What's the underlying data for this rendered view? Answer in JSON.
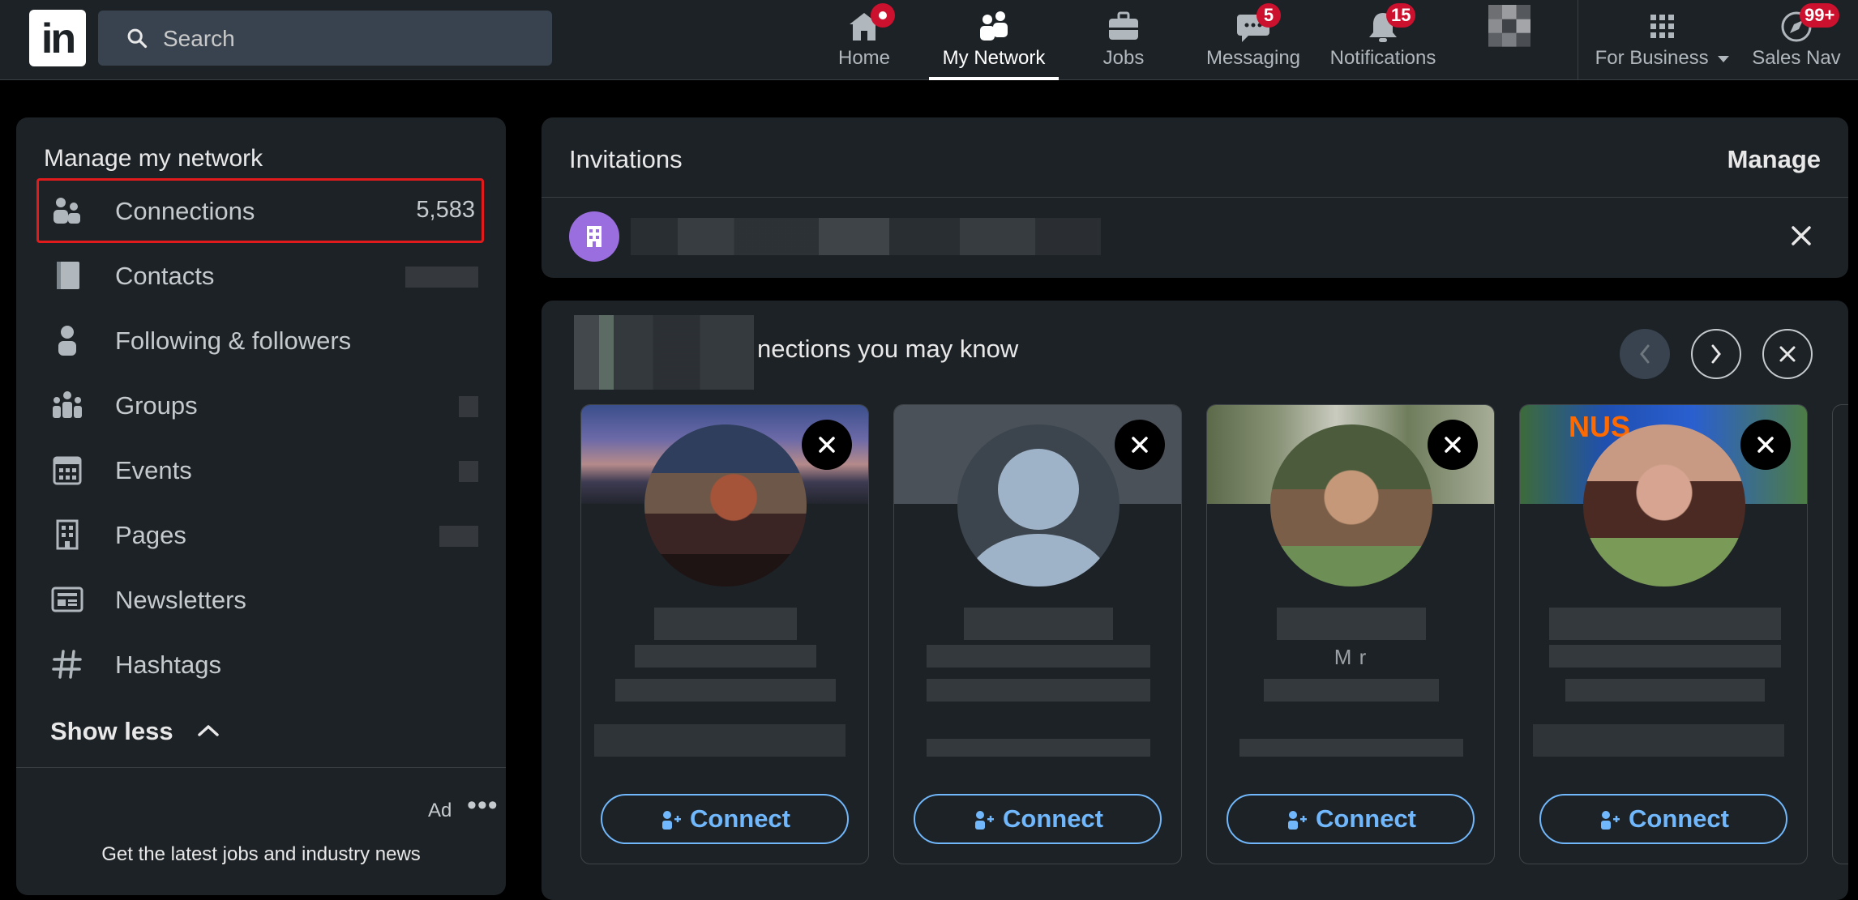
{
  "nav": {
    "logo_text": "in",
    "search_placeholder": "Search",
    "items": [
      {
        "label": "Home",
        "icon": "home-icon",
        "badge": ""
      },
      {
        "label": "My Network",
        "icon": "network-icon",
        "badge": ""
      },
      {
        "label": "Jobs",
        "icon": "briefcase-icon",
        "badge": ""
      },
      {
        "label": "Messaging",
        "icon": "messaging-icon",
        "badge": "5"
      },
      {
        "label": "Notifications",
        "icon": "bell-icon",
        "badge": "15"
      },
      {
        "label": "For Business",
        "icon": "grid-icon",
        "badge": ""
      },
      {
        "label": "Sales Nav",
        "icon": "compass-icon",
        "badge": "99+"
      }
    ],
    "active": "My Network"
  },
  "left": {
    "title": "Manage my network",
    "items": [
      {
        "label": "Connections",
        "count": "5,583",
        "icon": "people-icon"
      },
      {
        "label": "Contacts",
        "count": "",
        "icon": "contact-book-icon"
      },
      {
        "label": "Following & followers",
        "count": "",
        "icon": "person-icon"
      },
      {
        "label": "Groups",
        "count": "",
        "icon": "groups-icon"
      },
      {
        "label": "Events",
        "count": "",
        "icon": "calendar-icon"
      },
      {
        "label": "Pages",
        "count": "",
        "icon": "building-icon"
      },
      {
        "label": "Newsletters",
        "count": "",
        "icon": "newsletter-icon"
      },
      {
        "label": "Hashtags",
        "count": "",
        "icon": "hashtag-icon"
      }
    ],
    "show_less": "Show less",
    "ad_label": "Ad",
    "ad_text": "Get the latest jobs and industry news"
  },
  "invitations": {
    "title": "Invitations",
    "manage": "Manage"
  },
  "pymk": {
    "title": "nections you may know",
    "cards": [
      {
        "connect_label": "Connect",
        "job_partial": ""
      },
      {
        "connect_label": "Connect",
        "job_partial": ""
      },
      {
        "connect_label": "Connect",
        "job_partial": "M                    r"
      },
      {
        "connect_label": "Connect",
        "job_partial": ""
      }
    ],
    "card4_banner_text": "NUS"
  },
  "colors": {
    "nav_bg": "#1d2226",
    "accent_link": "#71b7fb",
    "badge_red": "#cb112d",
    "highlight_red": "#e11b1b"
  }
}
